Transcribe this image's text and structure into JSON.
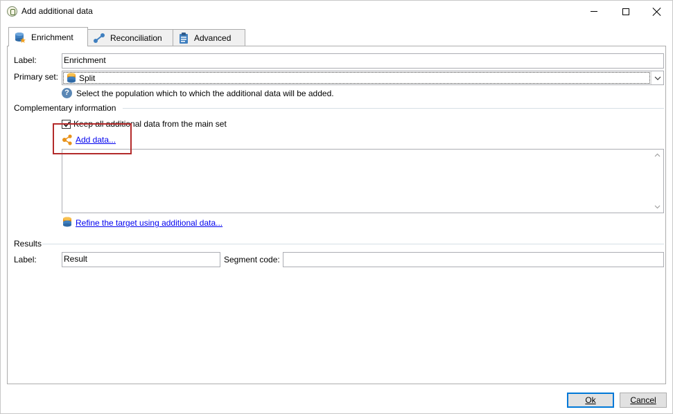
{
  "window": {
    "title": "Add additional data"
  },
  "tabs": [
    {
      "label": "Enrichment",
      "icon": "database-star-icon",
      "active": true
    },
    {
      "label": "Reconciliation",
      "icon": "link-nodes-icon",
      "active": false
    },
    {
      "label": "Advanced",
      "icon": "clipboard-icon",
      "active": false
    }
  ],
  "enrichment": {
    "label_caption": "Label:",
    "label_value": "Enrichment",
    "primary_set_caption": "Primary set:",
    "primary_set_value": "Split",
    "help_text": "Select the population which to which the additional data will be added.",
    "complementary_section": "Complementary information",
    "keep_all_label": "Keep all additional data from the main set",
    "keep_all_checked": true,
    "add_data_link": "Add data...",
    "refine_link": "Refine the target using additional data...",
    "results_section": "Results",
    "result_label_caption": "Label:",
    "result_label_value": "Result",
    "segment_code_caption": "Segment code:",
    "segment_code_value": ""
  },
  "buttons": {
    "ok_label": "Ok",
    "cancel_label": "Cancel"
  },
  "colors": {
    "link": "#0000ee",
    "highlight": "#b32a2a",
    "accent": "#0078d7"
  }
}
